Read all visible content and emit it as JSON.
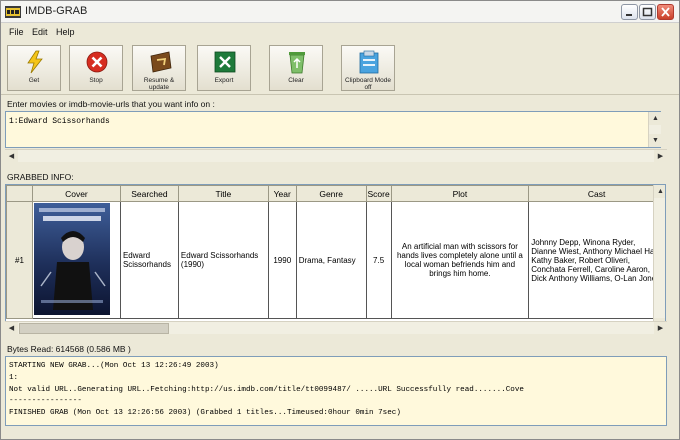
{
  "window": {
    "title": "IMDB-GRAB"
  },
  "menu": {
    "file": "File",
    "edit": "Edit",
    "help": "Help"
  },
  "toolbar": {
    "get": "Get",
    "stop": "Stop",
    "resume": "Resume & update",
    "export": "Export",
    "clear": "Clear",
    "clipboard": "Clipboard Mode off"
  },
  "input": {
    "label": "Enter movies or imdb-movie-urls that you want info on :",
    "value": "1:Edward Scissorhands"
  },
  "grabbed": {
    "label": "GRABBED INFO:",
    "columns": [
      "Cover",
      "Searched",
      "Title",
      "Year",
      "Genre",
      "Score",
      "Plot",
      "Cast"
    ],
    "rows": [
      {
        "num": "#1",
        "searched": "Edward Scissorhands",
        "title": "Edward Scissorhands (1990)",
        "year": "1990",
        "genre": "Drama, Fantasy",
        "score": "7.5",
        "plot": "An artificial man with scissors for hands lives completely alone until a local woman befriends him and brings him home.",
        "cast": "Johnny Depp, Winona Ryder, Dianne Wiest, Anthony Michael Hall, Kathy Baker, Robert Oliveri, Conchata Ferrell, Caroline Aaron, Dick Anthony Williams, O-Lan Jones"
      }
    ]
  },
  "status": {
    "bytes_read": "Bytes Read:  614568  (0.586 MB )"
  },
  "log": {
    "lines": [
      "STARTING NEW GRAB...(Mon Oct 13 12:26:49 2003)",
      "1:",
      "Not valid URL..Generating URL..Fetching:http://us.imdb.com/title/tt0099487/ .....URL Successfully read.......Cove",
      "----------------",
      "FINISHED GRAB (Mon Oct 13 12:26:56 2003) (Grabbed 1 titles...Timeused:0hour 0min 7sec)"
    ]
  }
}
